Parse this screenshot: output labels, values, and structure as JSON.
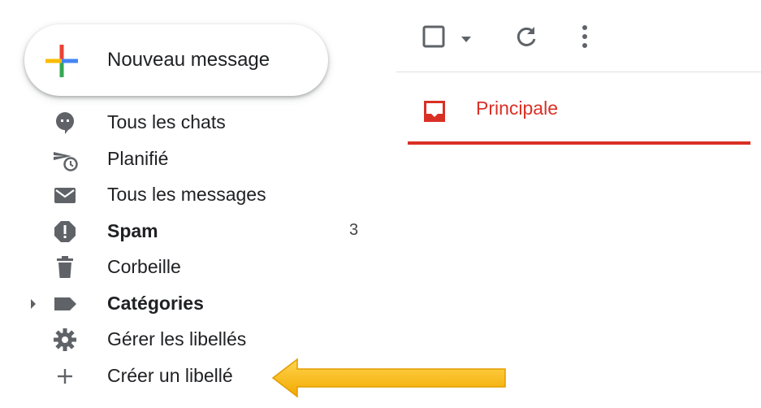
{
  "compose": {
    "label": "Nouveau message"
  },
  "nav": {
    "items": [
      {
        "label": "Tous les chats",
        "icon": "chat-icon"
      },
      {
        "label": "Planifié",
        "icon": "scheduled-send-icon"
      },
      {
        "label": "Tous les messages",
        "icon": "mail-icon"
      },
      {
        "label": "Spam",
        "icon": "spam-icon",
        "count": "3",
        "bold": true
      },
      {
        "label": "Corbeille",
        "icon": "trash-icon"
      },
      {
        "label": "Catégories",
        "icon": "label-icon",
        "bold": true,
        "expandable": true
      },
      {
        "label": "Gérer les libellés",
        "icon": "gear-icon"
      },
      {
        "label": "Créer un libellé",
        "icon": "plus-icon"
      }
    ]
  },
  "tabs": [
    {
      "label": "Principale",
      "icon": "inbox-icon",
      "active": true
    }
  ],
  "colors": {
    "accent_red": "#d93025",
    "arrow_yellow": "#fbbc04",
    "icon_grey": "#5f6368",
    "google_blue": "#4285f4",
    "google_red": "#ea4335",
    "google_yellow": "#fbbc04",
    "google_green": "#34a853"
  }
}
